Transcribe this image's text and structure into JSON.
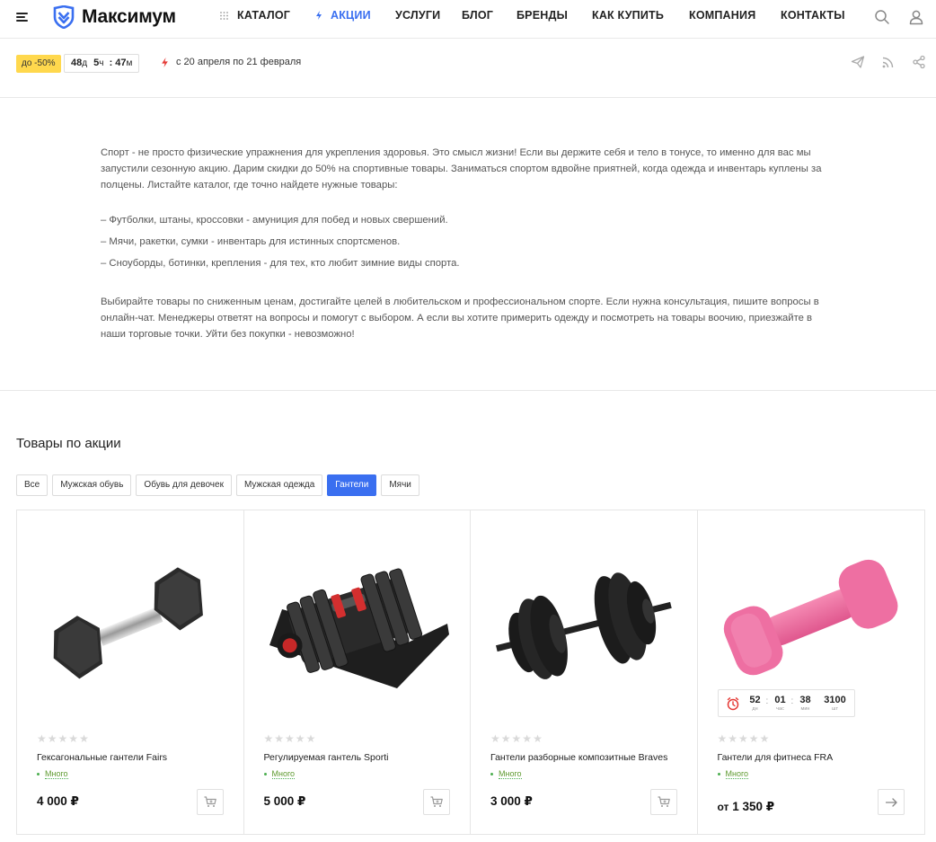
{
  "header": {
    "logo_text": "Максимум",
    "nav": [
      {
        "label": "КАТАЛОГ"
      },
      {
        "label": "АКЦИИ"
      },
      {
        "label": "УСЛУГИ"
      },
      {
        "label": "БЛОГ"
      },
      {
        "label": "БРЕНДЫ"
      },
      {
        "label": "КАК КУПИТЬ"
      },
      {
        "label": "КОМПАНИЯ"
      },
      {
        "label": "КОНТАКТЫ"
      }
    ],
    "active_nav": "АКЦИИ",
    "icons": [
      "menu-icon",
      "grid-dots-icon",
      "bolt-icon",
      "search-icon",
      "user-icon"
    ],
    "accent_color": "#3a6ff0"
  },
  "promo": {
    "discount_badge": "до -50%",
    "timer": {
      "days": "48",
      "days_unit": "д",
      "hours": "5",
      "hours_unit": "ч",
      "minutes": "47",
      "minutes_unit": "м"
    },
    "date_range": "с 20 апреля по 21 февраля",
    "share_icons": [
      "send-icon",
      "rss-icon",
      "share-icon"
    ],
    "badge_color": "#ffd84d"
  },
  "description": {
    "p1": "Спорт - не просто физические упражнения для укрепления здоровья. Это смысл жизни! Если вы держите себя и тело в тонусе, то именно для вас мы запустили сезонную акцию. Дарим скидки до 50% на спортивные товары. Заниматься спортом вдвойне приятней, когда одежда и инвентарь куплены за полцены. Листайте каталог, где точно найдете нужные товары:",
    "list": [
      "–  Футболки, штаны, кроссовки - амуниция для побед и новых свершений.",
      "–  Мячи, ракетки, сумки - инвентарь для истинных спортсменов.",
      "–  Сноуборды, ботинки, крепления - для тех, кто любит зимние виды спорта."
    ],
    "p2": "Выбирайте товары по сниженным ценам, достигайте целей в любительском и профессиональном спорте. Если нужна консультация, пишите вопросы в онлайн-чат. Менеджеры ответят на вопросы и помогут с выбором. А если вы хотите примерить одежду и посмотреть на товары воочию, приезжайте в наши торговые точки. Уйти без покупки - невозможно!"
  },
  "products_section": {
    "title": "Товары по акции",
    "filters": [
      "Все",
      "Мужская обувь",
      "Обувь для девочек",
      "Мужская одежда",
      "Гантели",
      "Мячи"
    ],
    "active_filter": "Гантели",
    "products": [
      {
        "name": "Гексагональные гантели Fairs",
        "stock": "Много",
        "price": "4 000 ₽",
        "rating": 0,
        "image": "hex-dumbbell",
        "action_icon": "cart-icon"
      },
      {
        "name": "Регулируемая гантель Sporti",
        "stock": "Много",
        "price": "5 000 ₽",
        "rating": 0,
        "image": "adjustable-dumbbell",
        "action_icon": "cart-icon"
      },
      {
        "name": "Гантели разборные композитные Braves",
        "stock": "Много",
        "price": "3 000 ₽",
        "rating": 0,
        "image": "plate-dumbbell",
        "action_icon": "cart-icon"
      },
      {
        "name": "Гантели для фитнеса FRA",
        "stock": "Много",
        "price_prefix": "от",
        "price": "1 350 ₽",
        "rating": 0,
        "image": "pink-dumbbell",
        "action_icon": "arrow-right-icon",
        "countdown": {
          "days": "52",
          "days_lbl": "дн",
          "hours": "01",
          "hours_lbl": "час",
          "minutes": "38",
          "minutes_lbl": "мин",
          "qty": "3100",
          "qty_lbl": "шт"
        }
      }
    ]
  }
}
